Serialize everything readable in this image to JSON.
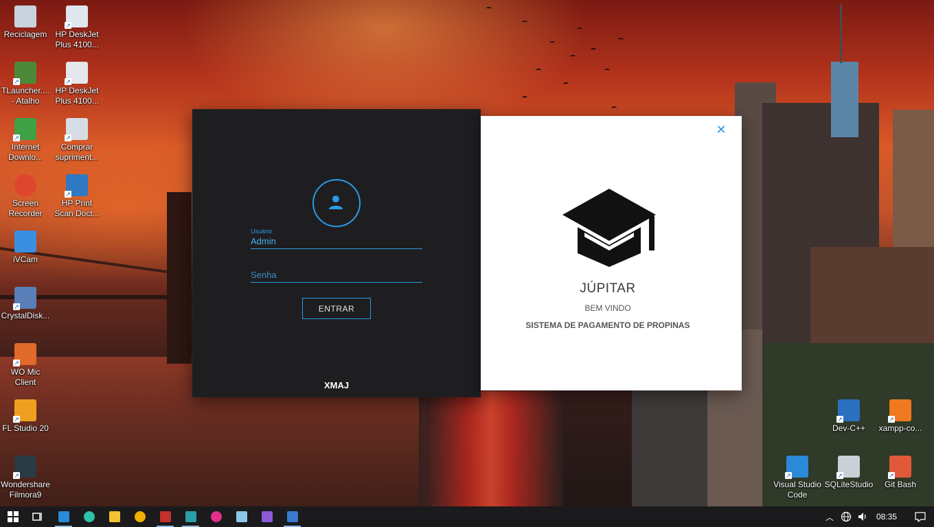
{
  "desktop": {
    "left_icons": [
      {
        "name": "recycle-bin-icon",
        "label": "Reciclagem",
        "color": "#c9d3de"
      },
      {
        "name": "hp-deskjet-1-icon",
        "label": "HP DeskJet\nPlus 4100...",
        "color": "#dfe6ee"
      },
      {
        "name": "tlauncher-icon",
        "label": "TLauncher....\n- Atalho",
        "color": "#4c8a3a"
      },
      {
        "name": "hp-deskjet-2-icon",
        "label": "HP DeskJet\nPlus 4100...",
        "color": "#e4e8ec"
      },
      {
        "name": "internet-download-icon",
        "label": "Internet\nDownlo...",
        "color": "#3fa046"
      },
      {
        "name": "comprar-suprimentos-icon",
        "label": "Comprar\nsupriment...",
        "color": "#d7dde4"
      },
      {
        "name": "screen-recorder-icon",
        "label": "Screen\nRecorder",
        "color": "#e0452f"
      },
      {
        "name": "hp-print-scan-icon",
        "label": "HP Print\nScan Doct...",
        "color": "#2f78c2"
      },
      {
        "name": "ivcam-icon",
        "label": "iVCam",
        "color": "#3b8fe0"
      },
      {
        "name": "crystaldisk-icon",
        "label": "CrystalDisk...",
        "color": "#5a7fb8"
      },
      {
        "name": "wo-mic-icon",
        "label": "WO Mic\nClient",
        "color": "#e06a2a"
      },
      {
        "name": "fl-studio-icon",
        "label": "FL Studio 20",
        "color": "#f0a020"
      },
      {
        "name": "filmora-icon",
        "label": "Wondershare\nFilmora9",
        "color": "#2b3b44"
      }
    ],
    "right_icons": [
      {
        "name": "dev-cpp-icon",
        "label": "Dev-C++",
        "color": "#2a6fc0"
      },
      {
        "name": "xampp-icon",
        "label": "xampp-co...",
        "color": "#f07a20"
      },
      {
        "name": "vscode-icon",
        "label": "Visual Studio\nCode",
        "color": "#2a8ad8"
      },
      {
        "name": "sqlitestudio-icon",
        "label": "SQLiteStudio",
        "color": "#c9d0d6"
      },
      {
        "name": "git-bash-icon",
        "label": "Git Bash",
        "color": "#e05a3a"
      }
    ]
  },
  "login": {
    "username_label": "Usuário",
    "username_value": "Admin",
    "password_placeholder": "Senha",
    "submit_label": "ENTRAR",
    "footer_brand": "XMAJ"
  },
  "welcome_panel": {
    "close_symbol": "✕",
    "app_title": "JÚPITAR",
    "welcome_text": "BEM VINDO",
    "subtitle": "SISTEMA DE PAGAMENTO DE PROPINAS"
  },
  "taskbar": {
    "apps": [
      {
        "name": "start-button",
        "icon": "windows-icon",
        "color": "#ffffff",
        "active": false
      },
      {
        "name": "task-view-button",
        "icon": "task-view-icon",
        "color": "#ffffff",
        "active": false
      },
      {
        "name": "taskbar-vscode",
        "icon": "vscode-icon",
        "color": "#2a8ad8",
        "active": true
      },
      {
        "name": "taskbar-edge",
        "icon": "edge-icon",
        "color": "#2ec0a8",
        "active": false
      },
      {
        "name": "taskbar-file-explorer",
        "icon": "folder-icon",
        "color": "#f2c232",
        "active": false
      },
      {
        "name": "taskbar-app-yellow",
        "icon": "app-yellow-icon",
        "color": "#f0b000",
        "active": false
      },
      {
        "name": "taskbar-access",
        "icon": "access-icon",
        "color": "#c4302b",
        "active": true
      },
      {
        "name": "taskbar-app-layers",
        "icon": "layers-icon",
        "color": "#2aa0a8",
        "active": true
      },
      {
        "name": "taskbar-app-pink",
        "icon": "app-pink-icon",
        "color": "#e0308a",
        "active": false
      },
      {
        "name": "taskbar-notepad",
        "icon": "notepad-icon",
        "color": "#8ec8e8",
        "active": false
      },
      {
        "name": "taskbar-visual-studio",
        "icon": "visual-studio-icon",
        "color": "#8a5ad8",
        "active": false
      },
      {
        "name": "taskbar-java-app",
        "icon": "java-app-icon",
        "color": "#3a7ad0",
        "active": true
      }
    ],
    "clock": "08:35"
  },
  "colors": {
    "accent": "#2b9be6",
    "dark_panel": "#1e1e21",
    "taskbar": "#1b1a1c"
  }
}
